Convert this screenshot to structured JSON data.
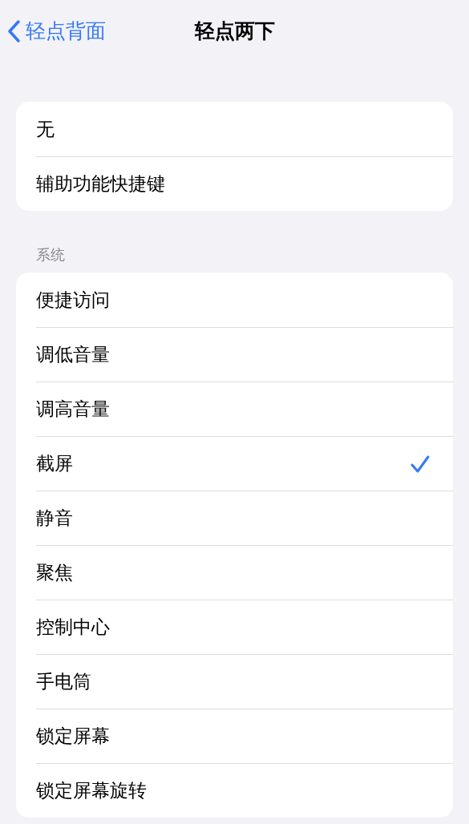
{
  "nav": {
    "back": "轻点背面",
    "title": "轻点两下"
  },
  "groups": [
    {
      "items": [
        {
          "label": "无",
          "selected": false
        },
        {
          "label": "辅助功能快捷键",
          "selected": false
        }
      ]
    },
    {
      "header": "系统",
      "items": [
        {
          "label": "便捷访问",
          "selected": false
        },
        {
          "label": "调低音量",
          "selected": false
        },
        {
          "label": "调高音量",
          "selected": false
        },
        {
          "label": "截屏",
          "selected": true
        },
        {
          "label": "静音",
          "selected": false
        },
        {
          "label": "聚焦",
          "selected": false
        },
        {
          "label": "控制中心",
          "selected": false
        },
        {
          "label": "手电筒",
          "selected": false
        },
        {
          "label": "锁定屏幕",
          "selected": false
        },
        {
          "label": "锁定屏幕旋转",
          "selected": false
        }
      ]
    }
  ]
}
